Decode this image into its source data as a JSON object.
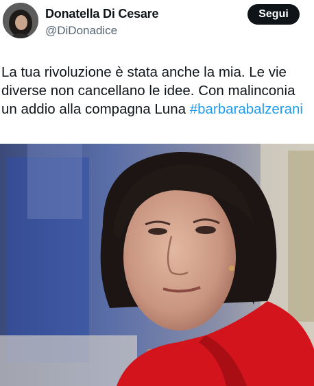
{
  "author": {
    "display_name": "Donatella Di Cesare",
    "handle": "@DiDonadice",
    "avatar_icon": "profile-photo-icon"
  },
  "follow_button": {
    "label": "Segui"
  },
  "tweet": {
    "line1": "La tua rivoluzione è stata anche la mia. Le vie",
    "line2": "diverse non cancellano le idee. Con malinconia",
    "line3_text": "un addio alla compagna Luna ",
    "hashtag": "#barbarabalzerani"
  },
  "colors": {
    "text": "#0f1419",
    "secondary_text": "#536471",
    "hashtag": "#1d9bf0",
    "button_bg": "#0f1419"
  }
}
